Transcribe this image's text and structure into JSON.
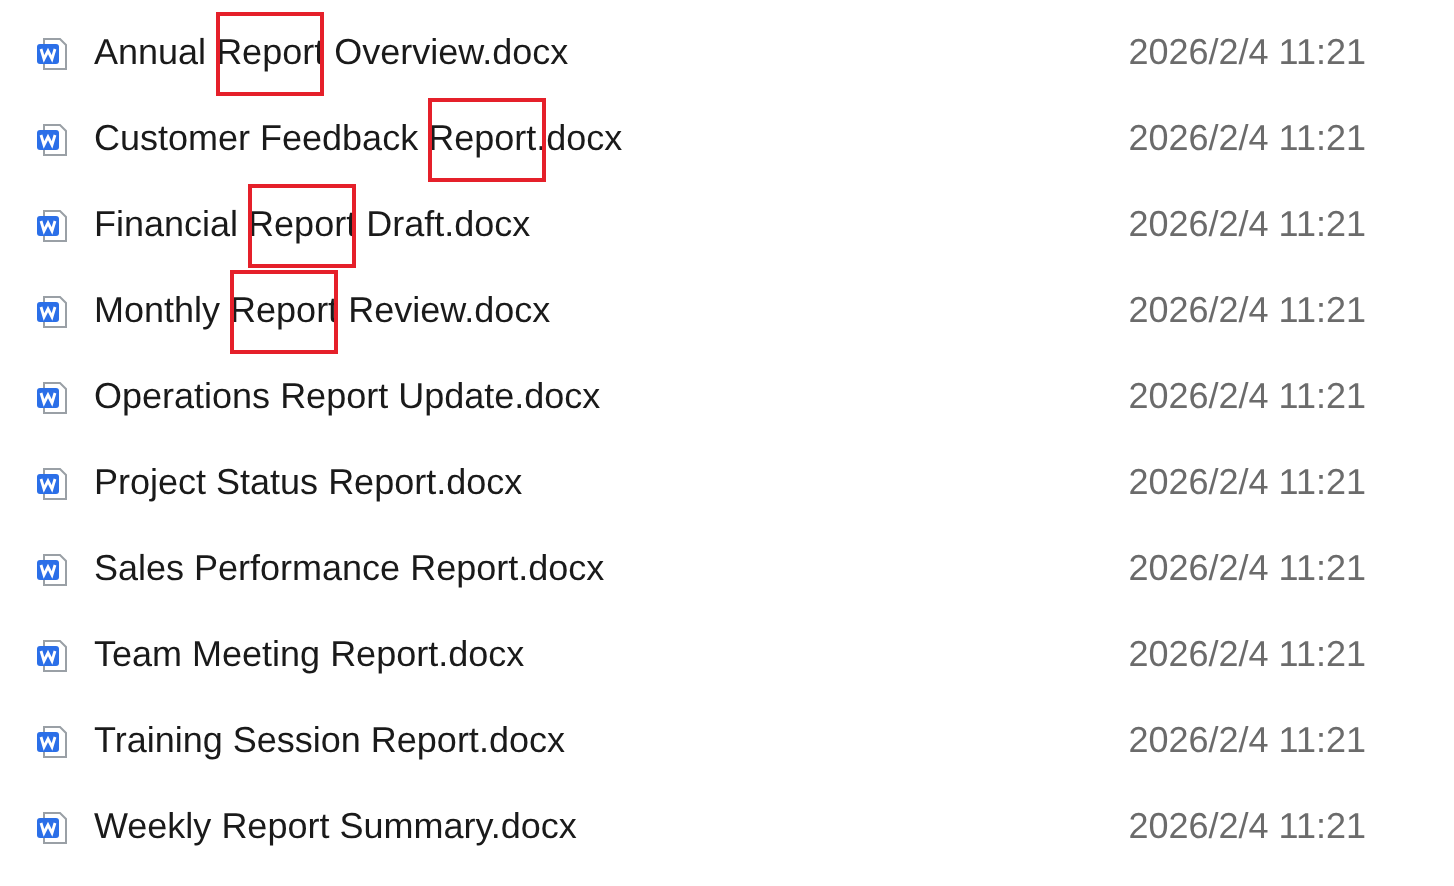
{
  "files": [
    {
      "before": "Annual ",
      "match": "Report",
      "after": " Overview.docx",
      "highlighted": true,
      "modified": "2026/2/4 11:21"
    },
    {
      "before": "Customer Feedback ",
      "match": "Report.",
      "after": "docx",
      "highlighted": true,
      "modified": "2026/2/4 11:21"
    },
    {
      "before": "Financial ",
      "match": "Report",
      "after": " Draft.docx",
      "highlighted": true,
      "modified": "2026/2/4 11:21"
    },
    {
      "before": "Monthly ",
      "match": "Report",
      "after": " Review.docx",
      "highlighted": true,
      "modified": "2026/2/4 11:21"
    },
    {
      "before": "Operations ",
      "match": "Report",
      "after": " Update.docx",
      "highlighted": false,
      "modified": "2026/2/4 11:21"
    },
    {
      "before": "Project Status ",
      "match": "Report",
      "after": ".docx",
      "highlighted": false,
      "modified": "2026/2/4 11:21"
    },
    {
      "before": "Sales Performance ",
      "match": "Report",
      "after": ".docx",
      "highlighted": false,
      "modified": "2026/2/4 11:21"
    },
    {
      "before": "Team Meeting ",
      "match": "Report",
      "after": ".docx",
      "highlighted": false,
      "modified": "2026/2/4 11:21"
    },
    {
      "before": "Training Session ",
      "match": "Report",
      "after": ".docx",
      "highlighted": false,
      "modified": "2026/2/4 11:21"
    },
    {
      "before": "Weekly ",
      "match": "Report",
      "after": " Summary.docx",
      "highlighted": false,
      "modified": "2026/2/4 11:21"
    }
  ]
}
